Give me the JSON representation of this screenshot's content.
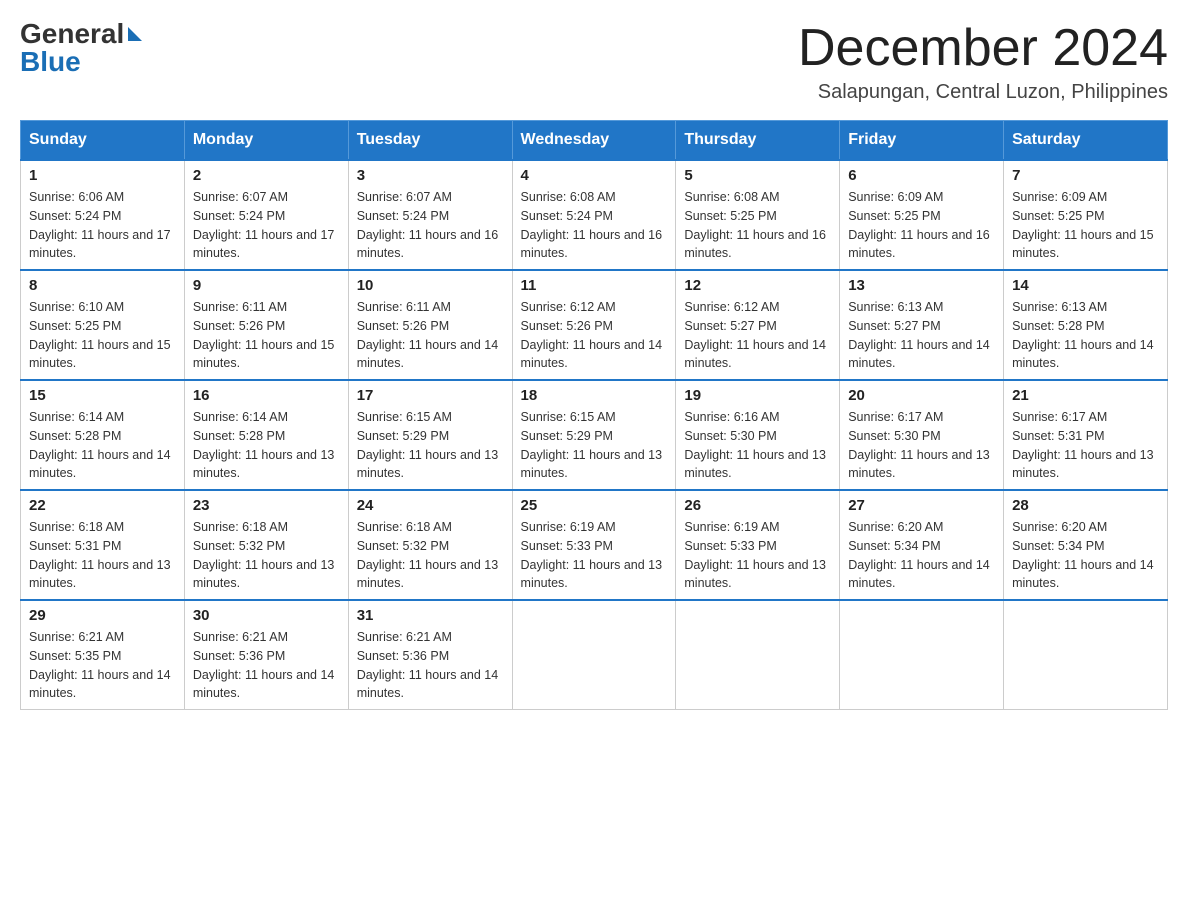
{
  "header": {
    "logo_general": "General",
    "logo_blue": "Blue",
    "month_title": "December 2024",
    "location": "Salapungan, Central Luzon, Philippines"
  },
  "days_of_week": [
    "Sunday",
    "Monday",
    "Tuesday",
    "Wednesday",
    "Thursday",
    "Friday",
    "Saturday"
  ],
  "weeks": [
    [
      {
        "day": "1",
        "sunrise": "6:06 AM",
        "sunset": "5:24 PM",
        "daylight": "11 hours and 17 minutes."
      },
      {
        "day": "2",
        "sunrise": "6:07 AM",
        "sunset": "5:24 PM",
        "daylight": "11 hours and 17 minutes."
      },
      {
        "day": "3",
        "sunrise": "6:07 AM",
        "sunset": "5:24 PM",
        "daylight": "11 hours and 16 minutes."
      },
      {
        "day": "4",
        "sunrise": "6:08 AM",
        "sunset": "5:24 PM",
        "daylight": "11 hours and 16 minutes."
      },
      {
        "day": "5",
        "sunrise": "6:08 AM",
        "sunset": "5:25 PM",
        "daylight": "11 hours and 16 minutes."
      },
      {
        "day": "6",
        "sunrise": "6:09 AM",
        "sunset": "5:25 PM",
        "daylight": "11 hours and 16 minutes."
      },
      {
        "day": "7",
        "sunrise": "6:09 AM",
        "sunset": "5:25 PM",
        "daylight": "11 hours and 15 minutes."
      }
    ],
    [
      {
        "day": "8",
        "sunrise": "6:10 AM",
        "sunset": "5:25 PM",
        "daylight": "11 hours and 15 minutes."
      },
      {
        "day": "9",
        "sunrise": "6:11 AM",
        "sunset": "5:26 PM",
        "daylight": "11 hours and 15 minutes."
      },
      {
        "day": "10",
        "sunrise": "6:11 AM",
        "sunset": "5:26 PM",
        "daylight": "11 hours and 14 minutes."
      },
      {
        "day": "11",
        "sunrise": "6:12 AM",
        "sunset": "5:26 PM",
        "daylight": "11 hours and 14 minutes."
      },
      {
        "day": "12",
        "sunrise": "6:12 AM",
        "sunset": "5:27 PM",
        "daylight": "11 hours and 14 minutes."
      },
      {
        "day": "13",
        "sunrise": "6:13 AM",
        "sunset": "5:27 PM",
        "daylight": "11 hours and 14 minutes."
      },
      {
        "day": "14",
        "sunrise": "6:13 AM",
        "sunset": "5:28 PM",
        "daylight": "11 hours and 14 minutes."
      }
    ],
    [
      {
        "day": "15",
        "sunrise": "6:14 AM",
        "sunset": "5:28 PM",
        "daylight": "11 hours and 14 minutes."
      },
      {
        "day": "16",
        "sunrise": "6:14 AM",
        "sunset": "5:28 PM",
        "daylight": "11 hours and 13 minutes."
      },
      {
        "day": "17",
        "sunrise": "6:15 AM",
        "sunset": "5:29 PM",
        "daylight": "11 hours and 13 minutes."
      },
      {
        "day": "18",
        "sunrise": "6:15 AM",
        "sunset": "5:29 PM",
        "daylight": "11 hours and 13 minutes."
      },
      {
        "day": "19",
        "sunrise": "6:16 AM",
        "sunset": "5:30 PM",
        "daylight": "11 hours and 13 minutes."
      },
      {
        "day": "20",
        "sunrise": "6:17 AM",
        "sunset": "5:30 PM",
        "daylight": "11 hours and 13 minutes."
      },
      {
        "day": "21",
        "sunrise": "6:17 AM",
        "sunset": "5:31 PM",
        "daylight": "11 hours and 13 minutes."
      }
    ],
    [
      {
        "day": "22",
        "sunrise": "6:18 AM",
        "sunset": "5:31 PM",
        "daylight": "11 hours and 13 minutes."
      },
      {
        "day": "23",
        "sunrise": "6:18 AM",
        "sunset": "5:32 PM",
        "daylight": "11 hours and 13 minutes."
      },
      {
        "day": "24",
        "sunrise": "6:18 AM",
        "sunset": "5:32 PM",
        "daylight": "11 hours and 13 minutes."
      },
      {
        "day": "25",
        "sunrise": "6:19 AM",
        "sunset": "5:33 PM",
        "daylight": "11 hours and 13 minutes."
      },
      {
        "day": "26",
        "sunrise": "6:19 AM",
        "sunset": "5:33 PM",
        "daylight": "11 hours and 13 minutes."
      },
      {
        "day": "27",
        "sunrise": "6:20 AM",
        "sunset": "5:34 PM",
        "daylight": "11 hours and 14 minutes."
      },
      {
        "day": "28",
        "sunrise": "6:20 AM",
        "sunset": "5:34 PM",
        "daylight": "11 hours and 14 minutes."
      }
    ],
    [
      {
        "day": "29",
        "sunrise": "6:21 AM",
        "sunset": "5:35 PM",
        "daylight": "11 hours and 14 minutes."
      },
      {
        "day": "30",
        "sunrise": "6:21 AM",
        "sunset": "5:36 PM",
        "daylight": "11 hours and 14 minutes."
      },
      {
        "day": "31",
        "sunrise": "6:21 AM",
        "sunset": "5:36 PM",
        "daylight": "11 hours and 14 minutes."
      },
      null,
      null,
      null,
      null
    ]
  ]
}
